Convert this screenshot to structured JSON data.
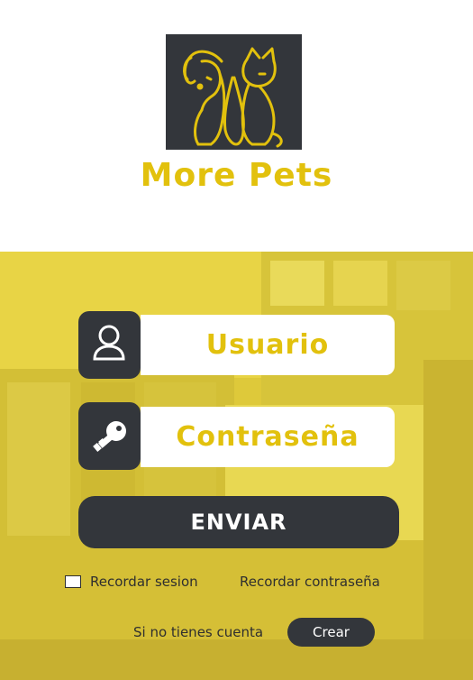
{
  "brand": {
    "name": "More Pets",
    "logo_icon": "dog-cat-logo-icon"
  },
  "login": {
    "user_placeholder": "Usuario",
    "user_icon": "user-icon",
    "password_placeholder": "Contraseña",
    "password_icon": "key-icon",
    "submit_label": "ENVIAR"
  },
  "options": {
    "remember_session": "Recordar sesion",
    "remember_password": "Recordar contraseña",
    "remember_session_checked": false
  },
  "signup": {
    "prompt": "Si no tienes cuenta",
    "create_label": "Crear"
  },
  "colors": {
    "accent": "#e2c10d",
    "dark": "#33363b",
    "background": "#ffffff"
  }
}
